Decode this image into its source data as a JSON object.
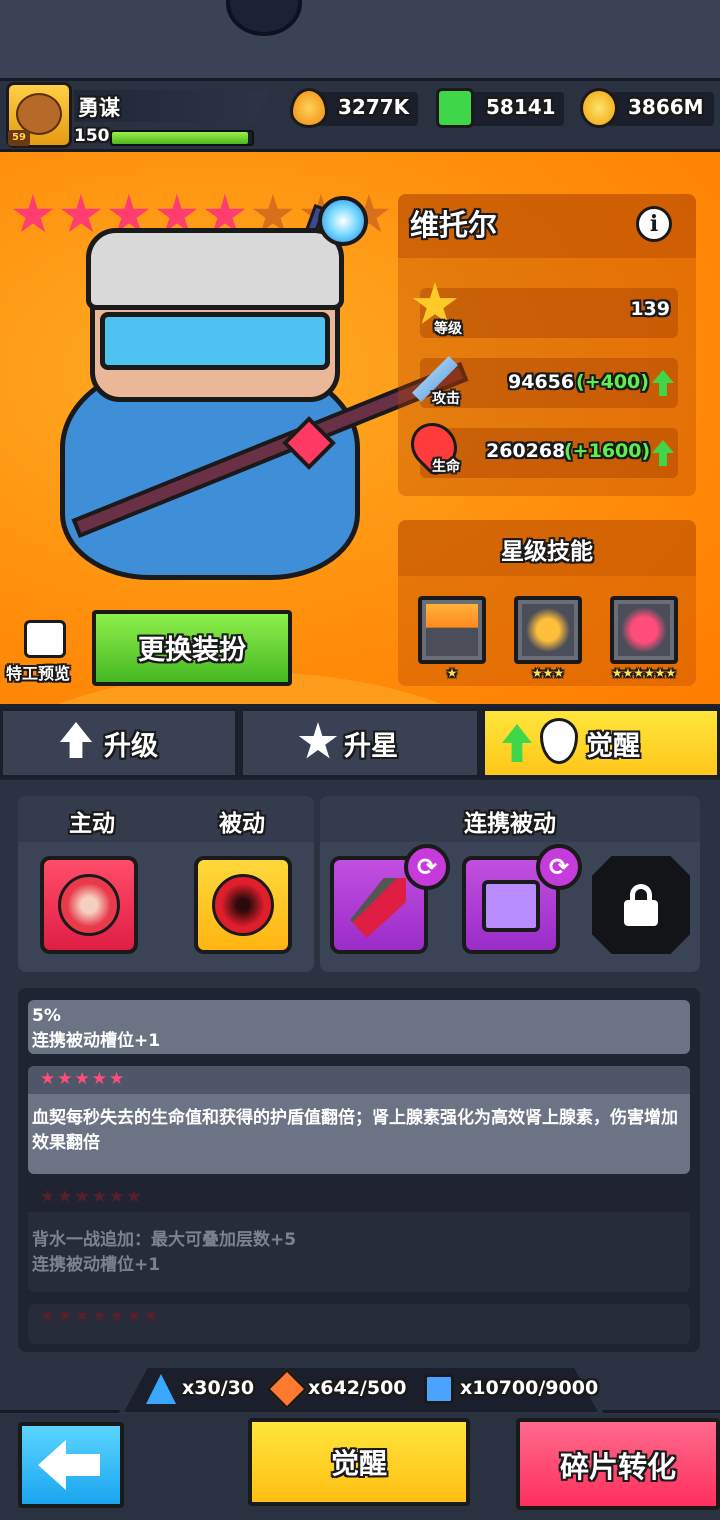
{
  "player": {
    "name": "勇谋",
    "level": "59",
    "xp_value": "150",
    "xp_fraction": 0.97
  },
  "currencies": [
    {
      "icon": "droplet-icon",
      "value": "3277K"
    },
    {
      "icon": "green-gem-icon",
      "value": "58141"
    },
    {
      "icon": "gold-coin-icon",
      "value": "3866M"
    }
  ],
  "hero": {
    "stars_filled": 5,
    "stars_total": 8,
    "name": "维托尔",
    "info_icon": "i",
    "level_label": "等级",
    "level_value": "139",
    "attack_label": "攻击",
    "attack_value": "94656",
    "attack_bonus": "(+400)",
    "hp_label": "生命",
    "hp_value": "260268",
    "hp_bonus": "(+1600)"
  },
  "star_skills": {
    "title": "星级技能",
    "skills": [
      {
        "icon": "torch-icon",
        "stars": "★"
      },
      {
        "icon": "horn-plus-icon",
        "stars": "★★★"
      },
      {
        "icon": "shield-icon",
        "stars": "★★★★★★"
      }
    ]
  },
  "preview": {
    "label": "特工预览"
  },
  "outfit_button": "更换装扮",
  "tabs": [
    {
      "label": "升级",
      "icon": "upgrade-arrow-icon"
    },
    {
      "label": "升星",
      "icon": "star-icon"
    },
    {
      "label": "觉醒",
      "icon": "flame-spirit-icon"
    }
  ],
  "skill_panels": {
    "active": "主动",
    "passive": "被动",
    "combo": "连携被动",
    "swap_symbol": "⟳"
  },
  "descriptions": [
    {
      "stars": "",
      "lines": "5%\n连携被动槽位+1",
      "dim": false
    },
    {
      "stars": "★★★★★",
      "lines": "血契每秒失去的生命值和获得的护盾值翻倍；肾上腺素强化为高效肾上腺素，伤害增加效果翻倍",
      "dim": false
    },
    {
      "stars": "★★★★★★",
      "lines": "背水一战追加：最大可叠加层数+5\n连携被动槽位+1",
      "dim": true
    },
    {
      "stars": "★★★★★★★",
      "lines": "",
      "dim": true
    }
  ],
  "resources": [
    {
      "icon": "triangle-shard-icon",
      "value": "x30/30"
    },
    {
      "icon": "scroll-shard-icon",
      "value": "x642/500"
    },
    {
      "icon": "crystal-shard-icon",
      "value": "x10700/9000"
    }
  ],
  "buttons": {
    "awaken": "觉醒",
    "convert": "碎片转化"
  },
  "colors": {
    "panel_orange": "#ff8c0b",
    "active_tab": "#ffd42a",
    "star_pink": "#ff3d6e",
    "bonus_green": "#5cf04e",
    "convert_red": "#ff2f5d"
  }
}
